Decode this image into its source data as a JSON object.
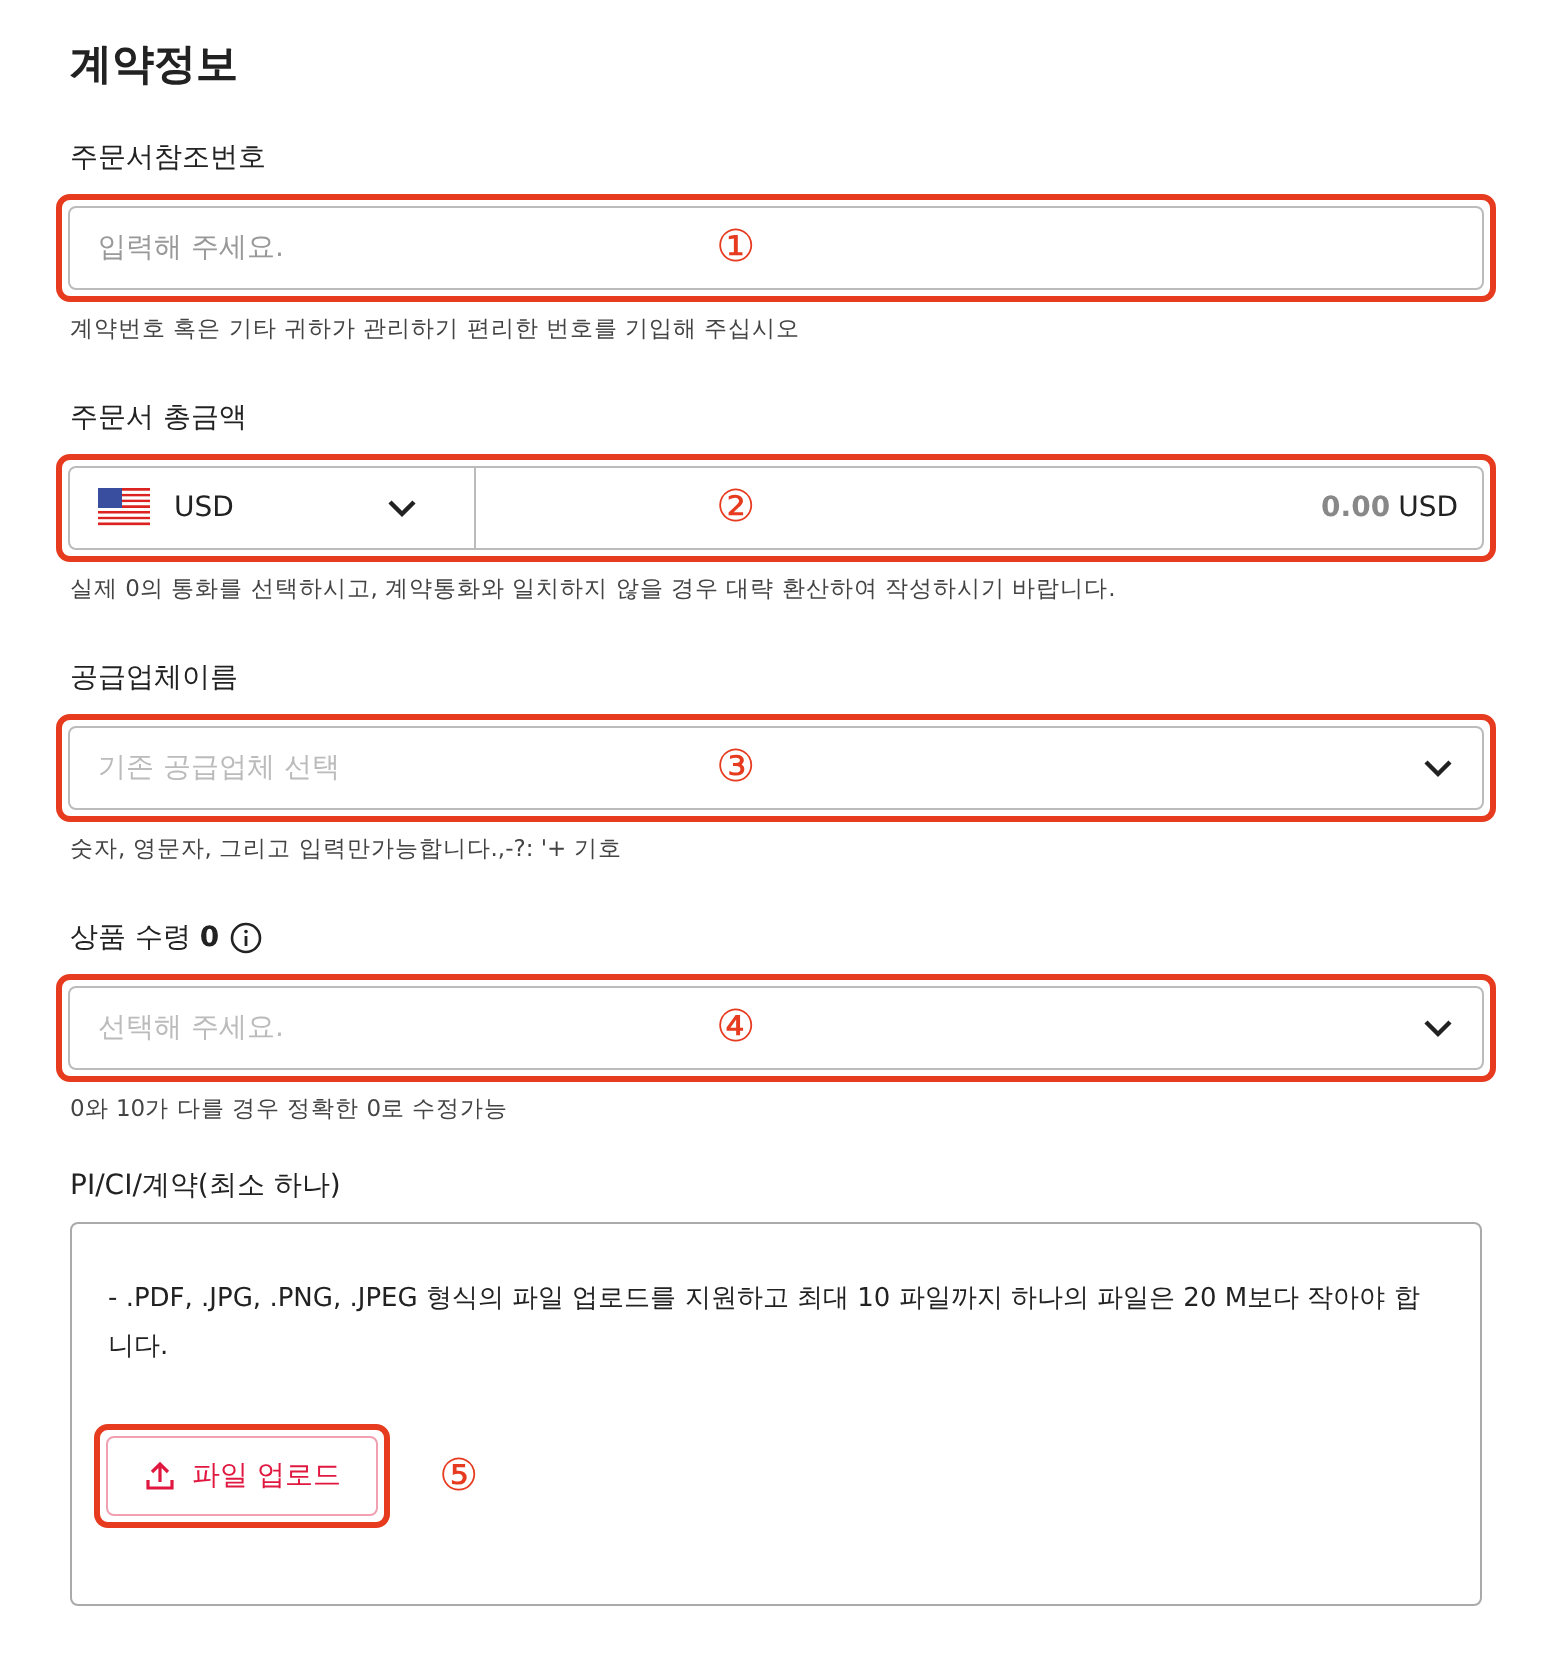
{
  "title": "계약정보",
  "fields": [
    {
      "kind": "text",
      "label": "주문서참조번호",
      "placeholder": "입력해 주세요.",
      "helper": "계약번호 혹은 기타 귀하가 관리하기 편리한 번호를 기입해 주십시오",
      "marker": "①"
    },
    {
      "kind": "amount",
      "label": "주문서 총금액",
      "currency": "USD",
      "amount": "0.00",
      "unit": "USD",
      "helper": "실제 0의 통화를 선택하시고, 계약통화와 일치하지 않을 경우 대략 환산하여 작성하시기 바랍니다.",
      "marker": "②"
    },
    {
      "kind": "select",
      "label": "공급업체이름",
      "placeholder": "기존 공급업체 선택",
      "helper": "숫자, 영문자, 그리고 입력만가능합니다.,-?: '+ 기호",
      "marker": "③"
    },
    {
      "kind": "select",
      "label": "상품 수령 **0**",
      "info": true,
      "placeholder": "선택해 주세요.",
      "helper": "0와 10가 다를 경우 정확한 0로 수정가능",
      "marker": "④"
    }
  ],
  "upload": {
    "label": "PI/CI/계약(최소 하나)",
    "note": "- .PDF, .JPG, .PNG, .JPEG 형식의 파일 업로드를 지원하고 최대 10 파일까지 하나의 파일은 20 M보다 작아야 합니다.",
    "button": "파일 업로드",
    "marker": "⑤"
  }
}
